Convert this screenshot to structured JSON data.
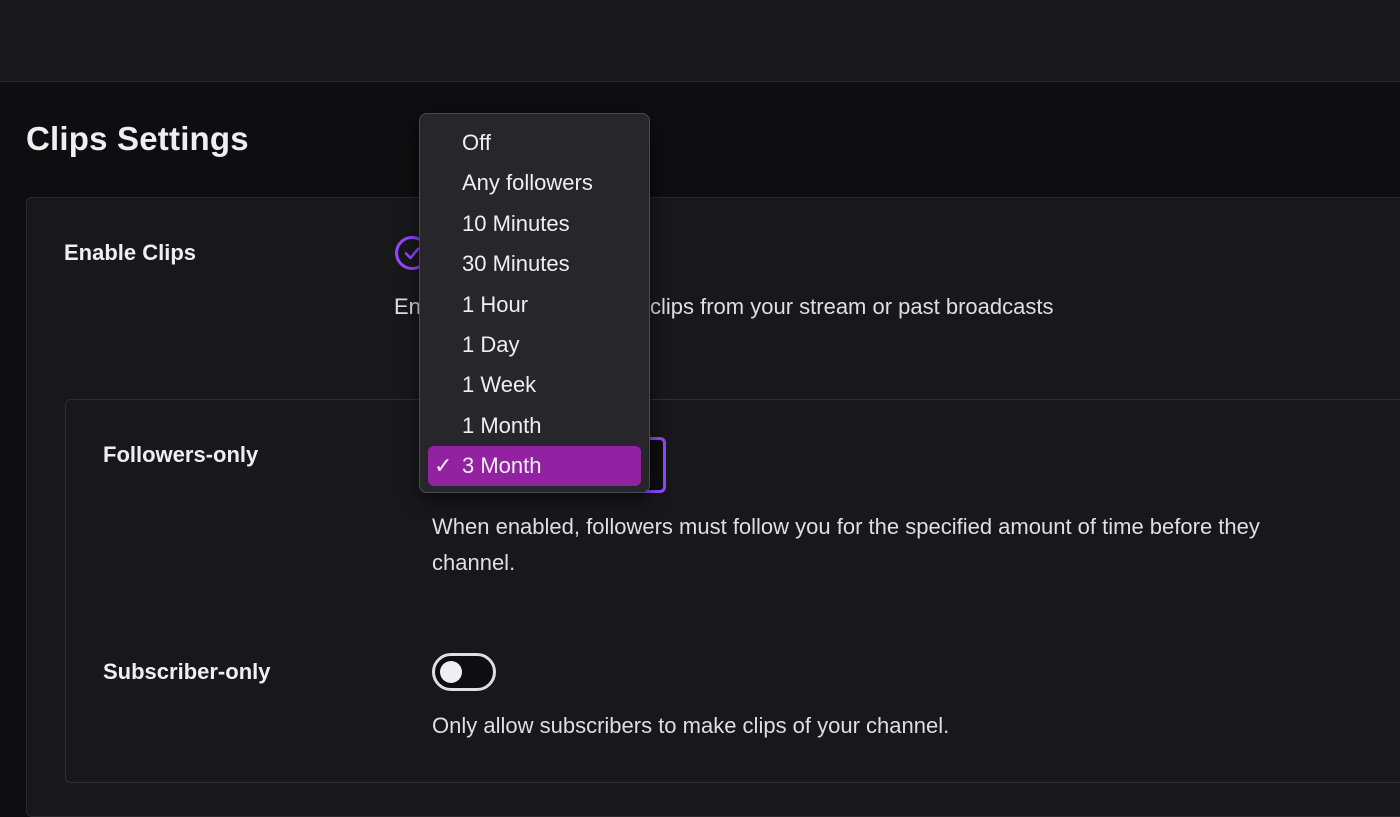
{
  "page": {
    "title": "Clips Settings"
  },
  "enable_clips": {
    "label": "Enable Clips",
    "description_start": "En",
    "description_end": "clips from your stream or past broadcasts",
    "checked": true
  },
  "followers_only": {
    "label": "Followers-only",
    "description": "When enabled, followers must follow you for the specified amount of time before they",
    "description_line2": "channel.",
    "selected": "3 Month"
  },
  "subscriber_only": {
    "label": "Subscriber-only",
    "description": "Only allow subscribers to make clips of your channel.",
    "enabled": false
  },
  "dropdown": {
    "options": [
      "Off",
      "Any followers",
      "10 Minutes",
      "30 Minutes",
      "1 Hour",
      "1 Day",
      "1 Week",
      "1 Month"
    ],
    "selected_label": "3 Month",
    "check_glyph": "✓"
  },
  "colors": {
    "accent": "#9147ff",
    "selected_option": "#9322a3",
    "background": "#0e0e10",
    "card": "#18181b"
  },
  "icons": {
    "enable_check": "check-circle-icon",
    "selected_check": "checkmark-icon"
  }
}
